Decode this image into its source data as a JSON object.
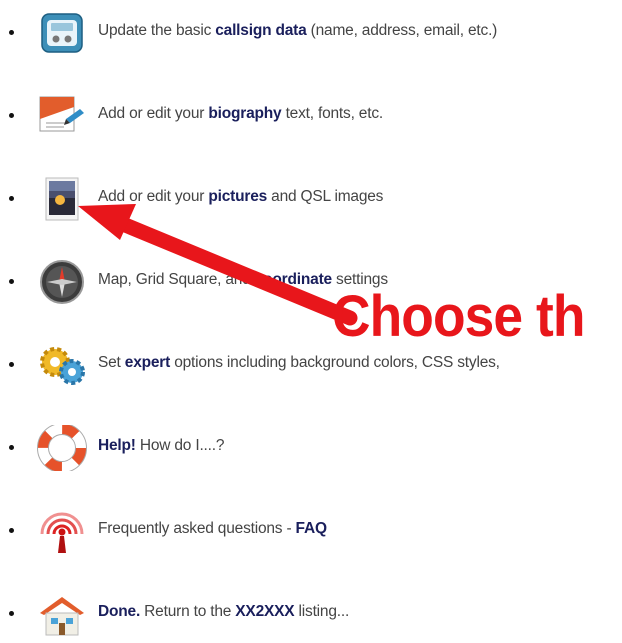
{
  "menu": {
    "items": [
      {
        "pre": "Update the basic ",
        "kw": "callsign data",
        "post": " (name, address, email, etc.)",
        "icon": "callsign-data-icon"
      },
      {
        "pre": "Add or edit your ",
        "kw": "biography",
        "post": " text, fonts, etc.",
        "icon": "biography-icon"
      },
      {
        "pre": "Add or edit your ",
        "kw": "pictures",
        "post": " and QSL images",
        "icon": "pictures-icon"
      },
      {
        "pre": "Map, Grid Square, and ",
        "kw": "coordinate",
        "post": " settings",
        "icon": "compass-icon"
      },
      {
        "pre": "Set ",
        "kw": "expert",
        "post": " options including background colors, CSS styles,",
        "icon": "gears-icon"
      },
      {
        "kw": "Help!",
        "post": "  How do I....?",
        "icon": "lifebuoy-icon"
      },
      {
        "pre": "Frequently asked questions - ",
        "kw": "FAQ",
        "icon": "antenna-icon"
      },
      {
        "kw": "Done.",
        "mid": "  Return to the ",
        "kw2": "XX2XXX",
        "post": " listing...",
        "icon": "home-icon"
      }
    ]
  },
  "annotation": {
    "text": "Choose th",
    "color": "#e8161b"
  }
}
